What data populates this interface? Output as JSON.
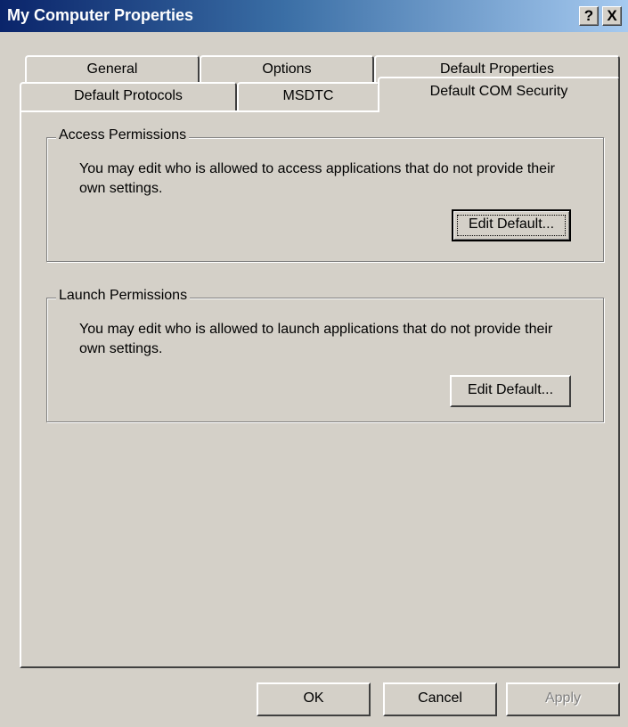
{
  "window": {
    "title": "My Computer Properties",
    "help_button": "?",
    "close_button": "X"
  },
  "tabs": {
    "back_row": [
      "General",
      "Options",
      "Default Properties"
    ],
    "front_row": [
      "Default Protocols",
      "MSDTC",
      "Default COM Security"
    ],
    "active": "Default COM Security"
  },
  "access_permissions": {
    "label": "Access Permissions",
    "description": "You may edit who is allowed to access applications that do not provide their own settings.",
    "button": "Edit Default..."
  },
  "launch_permissions": {
    "label": "Launch Permissions",
    "description": "You may edit who is allowed to launch applications that do not provide their own settings.",
    "button": "Edit Default..."
  },
  "footer": {
    "ok": "OK",
    "cancel": "Cancel",
    "apply": "Apply"
  }
}
